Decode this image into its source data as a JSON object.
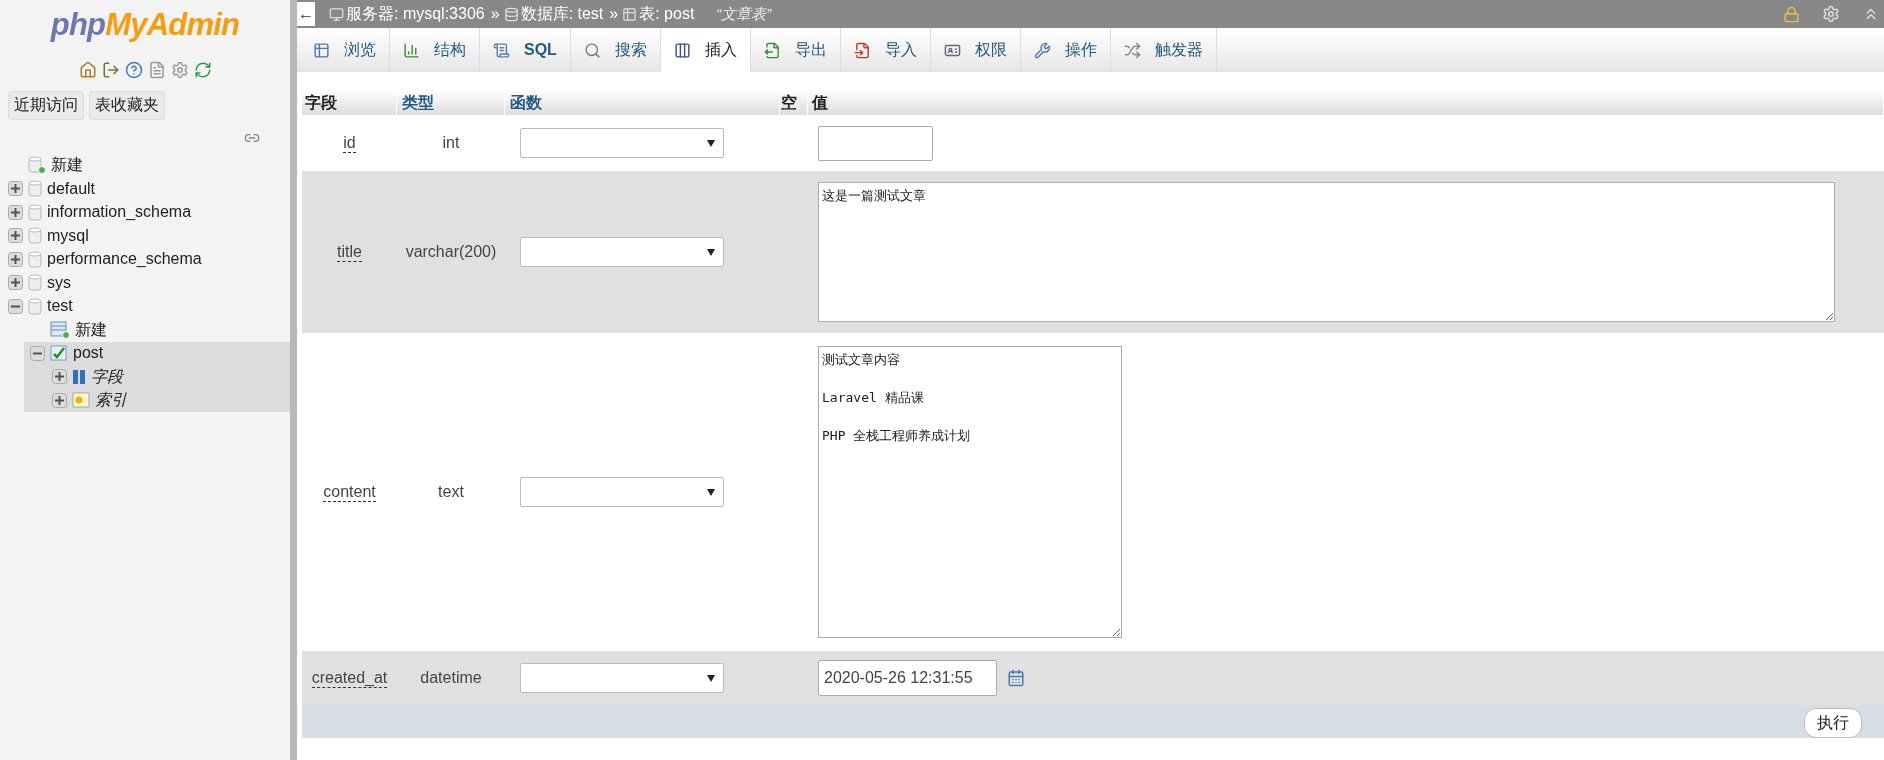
{
  "sidebar": {
    "logo": {
      "part_1": "php",
      "part_2": "MyAdmin"
    },
    "buttons": [
      "近期访问",
      "表收藏夹"
    ],
    "tree": [
      {
        "label": "新建",
        "kind": "new_db",
        "selected": false
      },
      {
        "label": "default",
        "kind": "db",
        "expanded": false,
        "selected": false
      },
      {
        "label": "information_schema",
        "kind": "db",
        "expanded": false,
        "selected": false
      },
      {
        "label": "mysql",
        "kind": "db",
        "expanded": false,
        "selected": false
      },
      {
        "label": "performance_schema",
        "kind": "db",
        "expanded": false,
        "selected": false
      },
      {
        "label": "sys",
        "kind": "db",
        "expanded": false,
        "selected": false
      },
      {
        "label": "test",
        "kind": "db",
        "expanded": true,
        "selected": false,
        "children": [
          {
            "label": "新建",
            "kind": "new_table",
            "selected": false
          },
          {
            "label": "post",
            "kind": "table",
            "expanded": true,
            "selected": true,
            "children": [
              {
                "label": "字段",
                "kind": "columns",
                "expanded": false,
                "selected": false
              },
              {
                "label": "索引",
                "kind": "indexes",
                "expanded": false,
                "selected": false
              }
            ]
          }
        ]
      }
    ]
  },
  "breadcrumb": {
    "back": "←",
    "items": [
      {
        "kind": "server",
        "label": "服务器: mysql:3306",
        "separator": "»"
      },
      {
        "kind": "database",
        "label": "数据库: test",
        "separator": "»"
      },
      {
        "kind": "table",
        "label": "表: post"
      }
    ],
    "comment": "“文章表”"
  },
  "tabs": [
    {
      "kind": "browse",
      "label": "浏览",
      "selected": false
    },
    {
      "kind": "structure",
      "label": "结构",
      "selected": false
    },
    {
      "kind": "sql",
      "label": "SQL",
      "selected": false
    },
    {
      "kind": "search",
      "label": "搜索",
      "selected": false
    },
    {
      "kind": "insert",
      "label": "插入",
      "selected": true
    },
    {
      "kind": "export",
      "label": "导出",
      "selected": false
    },
    {
      "kind": "import",
      "label": "导入",
      "selected": false
    },
    {
      "kind": "privileges",
      "label": "权限",
      "selected": false
    },
    {
      "kind": "operations",
      "label": "操作",
      "selected": false
    },
    {
      "kind": "triggers",
      "label": "触发器",
      "selected": false
    }
  ],
  "table": {
    "columns": [
      {
        "label": "字段",
        "sortable": false
      },
      {
        "label": "类型",
        "sortable": true
      },
      {
        "label": "函数",
        "sortable": true
      },
      {
        "label": "空",
        "sortable": false
      },
      {
        "label": "值",
        "sortable": false
      }
    ],
    "rows": [
      {
        "field": "id",
        "type": "int",
        "kind": "input"
      },
      {
        "field": "title",
        "type": "varchar(200)",
        "kind": "textarea_wide",
        "value": "这是一篇测试文章"
      },
      {
        "field": "content",
        "type": "text",
        "kind": "textarea",
        "value": "测试文章内容\n\nLaravel 精品课\n\nPHP 全栈工程师养成计划"
      },
      {
        "field": "created_at",
        "type": "datetime",
        "kind": "datetime",
        "value": "2020-05-26 12:31:55"
      }
    ]
  },
  "submit_button": "执行"
}
